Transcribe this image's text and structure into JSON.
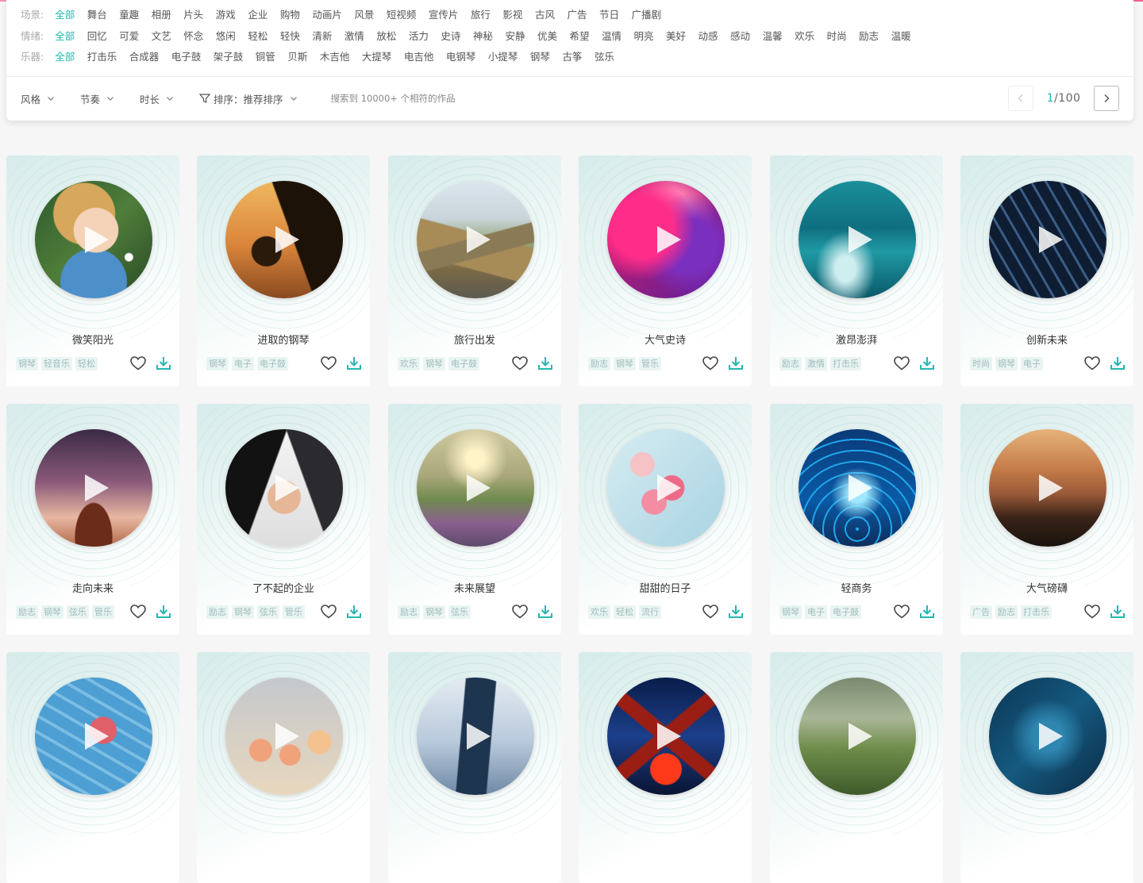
{
  "filters": [
    {
      "label": "场景:",
      "options": [
        "全部",
        "舞台",
        "童趣",
        "相册",
        "片头",
        "游戏",
        "企业",
        "购物",
        "动画片",
        "风景",
        "短视频",
        "宣传片",
        "旅行",
        "影视",
        "古风",
        "广告",
        "节日",
        "广播剧"
      ]
    },
    {
      "label": "情绪:",
      "options": [
        "全部",
        "回忆",
        "可爱",
        "文艺",
        "怀念",
        "悠闲",
        "轻松",
        "轻快",
        "清新",
        "激情",
        "放松",
        "活力",
        "史诗",
        "神秘",
        "安静",
        "优美",
        "希望",
        "温情",
        "明亮",
        "美好",
        "动感",
        "感动",
        "温馨",
        "欢乐",
        "时尚",
        "励志",
        "温暖"
      ]
    },
    {
      "label": "乐器:",
      "options": [
        "全部",
        "打击乐",
        "合成器",
        "电子鼓",
        "架子鼓",
        "铜管",
        "贝斯",
        "木吉他",
        "大提琴",
        "电吉他",
        "电钢琴",
        "小提琴",
        "钢琴",
        "古筝",
        "弦乐"
      ]
    }
  ],
  "toolbar": {
    "style_label": "风格",
    "rhythm_label": "节奏",
    "duration_label": "时长",
    "sort_label": "排序：推荐排序",
    "result_text": "搜索到 10000+ 个相符的作品"
  },
  "pager": {
    "current": "1",
    "total": "/100"
  },
  "colors": {
    "accent": "#23b8b0",
    "tag_text": "#9dbdbb",
    "tag_bg": "#eaf4f3",
    "top_line": "#f06292"
  },
  "cards": [
    {
      "title": "微笑阳光",
      "tags": [
        "钢琴",
        "轻音乐",
        "轻松"
      ],
      "cover": "smiling-child"
    },
    {
      "title": "进取的钢琴",
      "tags": [
        "钢琴",
        "电子",
        "电子鼓"
      ],
      "cover": "climbers-silhouette"
    },
    {
      "title": "旅行出发",
      "tags": [
        "欢乐",
        "钢琴",
        "电子鼓"
      ],
      "cover": "mountain-road"
    },
    {
      "title": "大气史诗",
      "tags": [
        "励志",
        "钢琴",
        "管乐"
      ],
      "cover": "color-smoke"
    },
    {
      "title": "激昂澎湃",
      "tags": [
        "励志",
        "激情",
        "打击乐"
      ],
      "cover": "surfer-wave"
    },
    {
      "title": "创新未来",
      "tags": [
        "时尚",
        "钢琴",
        "电子"
      ],
      "cover": "city-skyscrapers"
    },
    {
      "title": "走向未来",
      "tags": [
        "励志",
        "钢琴",
        "弦乐",
        "管乐"
      ],
      "cover": "success-sunset"
    },
    {
      "title": "了不起的企业",
      "tags": [
        "励志",
        "钢琴",
        "弦乐",
        "管乐"
      ],
      "cover": "handshake"
    },
    {
      "title": "未来展望",
      "tags": [
        "励志",
        "钢琴",
        "弦乐"
      ],
      "cover": "meadow-sunrise"
    },
    {
      "title": "甜甜的日子",
      "tags": [
        "欢乐",
        "轻松",
        "流行"
      ],
      "cover": "sweets"
    },
    {
      "title": "轻商务",
      "tags": [
        "钢琴",
        "电子",
        "电子鼓"
      ],
      "cover": "digital-tech"
    },
    {
      "title": "大气磅礴",
      "tags": [
        "广告",
        "励志",
        "打击乐"
      ],
      "cover": "concert-hall"
    },
    {
      "title": "",
      "tags": [],
      "cover": "starfish-wood"
    },
    {
      "title": "",
      "tags": [],
      "cover": "cartoon-kids"
    },
    {
      "title": "",
      "tags": [],
      "cover": "tall-building"
    },
    {
      "title": "",
      "tags": [],
      "cover": "red-lantern"
    },
    {
      "title": "",
      "tags": [],
      "cover": "green-landscape"
    },
    {
      "title": "",
      "tags": [],
      "cover": "blue-abstract"
    }
  ]
}
